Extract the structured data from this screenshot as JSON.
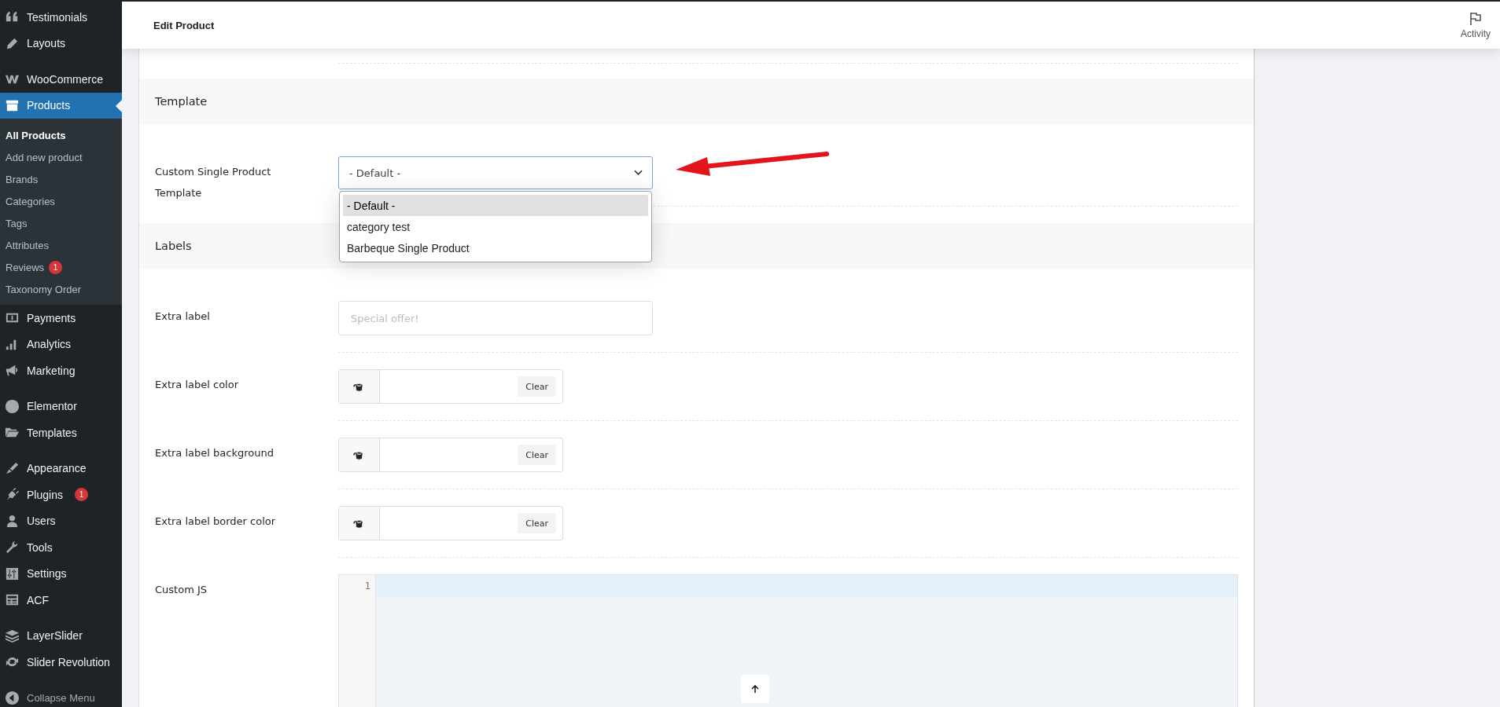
{
  "sidebar": {
    "groups": [
      [
        {
          "label": "Testimonials",
          "selected": false
        },
        {
          "label": "Layouts",
          "selected": false
        }
      ],
      [
        {
          "label": "WooCommerce",
          "selected": false
        },
        {
          "label": "Products",
          "selected": true,
          "children": [
            {
              "label": "All Products",
              "selected": true
            },
            {
              "label": "Add new product",
              "selected": false
            },
            {
              "label": "Brands",
              "selected": false
            },
            {
              "label": "Categories",
              "selected": false
            },
            {
              "label": "Tags",
              "selected": false
            },
            {
              "label": "Attributes",
              "selected": false
            },
            {
              "label": "Reviews",
              "selected": false,
              "badge": "1"
            },
            {
              "label": "Taxonomy Order",
              "selected": false
            }
          ]
        },
        {
          "label": "Payments",
          "selected": false
        },
        {
          "label": "Analytics",
          "selected": false
        },
        {
          "label": "Marketing",
          "selected": false
        }
      ],
      [
        {
          "label": "Elementor",
          "selected": false
        },
        {
          "label": "Templates",
          "selected": false
        }
      ],
      [
        {
          "label": "Appearance",
          "selected": false
        },
        {
          "label": "Plugins",
          "selected": false,
          "badge": "1"
        },
        {
          "label": "Users",
          "selected": false
        },
        {
          "label": "Tools",
          "selected": false
        },
        {
          "label": "Settings",
          "selected": false
        },
        {
          "label": "ACF",
          "selected": false
        }
      ],
      [
        {
          "label": "LayerSlider",
          "selected": false
        },
        {
          "label": "Slider Revolution",
          "selected": false
        }
      ]
    ],
    "collapse": {
      "label": "Collapse Menu"
    }
  },
  "header": {
    "title": "Edit Product",
    "activity": "Activity"
  },
  "sections": [
    {
      "title": "Template",
      "fields": [
        {
          "kind": "select",
          "label": "Custom Single Product Template",
          "value": "- Default -",
          "open": true,
          "options": [
            {
              "label": "- Default -",
              "selected": true
            },
            {
              "label": "category test",
              "selected": false
            },
            {
              "label": "Barbeque Single Product",
              "selected": false
            }
          ]
        }
      ]
    },
    {
      "title": "Labels",
      "fields": [
        {
          "kind": "text",
          "label": "Extra label",
          "placeholder": "Special offer!"
        },
        {
          "kind": "color",
          "label": "Extra label color",
          "clear": "Clear"
        },
        {
          "kind": "color",
          "label": "Extra label background",
          "clear": "Clear"
        },
        {
          "kind": "color",
          "label": "Extra label border color",
          "clear": "Clear"
        },
        {
          "kind": "code",
          "label": "Custom JS",
          "line_numbers": [
            "1"
          ]
        }
      ]
    }
  ]
}
